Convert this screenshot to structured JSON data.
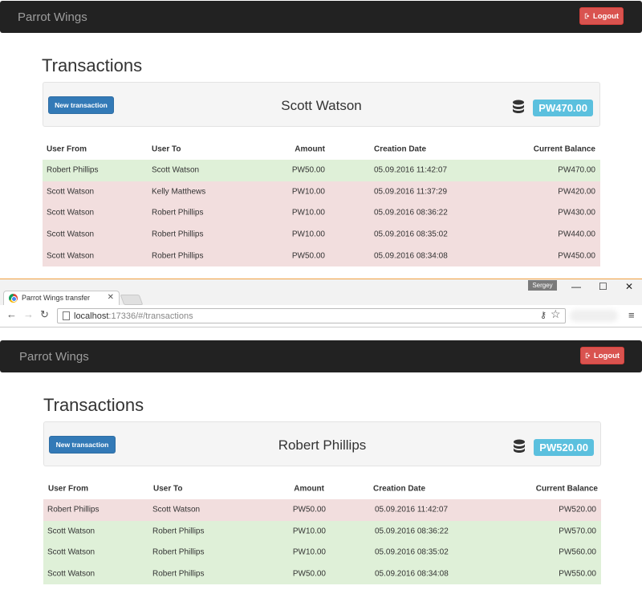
{
  "app": {
    "brand": "Parrot Wings",
    "logout_label": "Logout"
  },
  "table_headers": [
    "User From",
    "User To",
    "Amount",
    "Creation Date",
    "Current Balance"
  ],
  "top_view": {
    "title": "Transactions",
    "new_transaction_label": "New transaction",
    "user_name": "Scott Watson",
    "balance": "PW470.00",
    "rows": [
      {
        "status": "green",
        "from": "Robert Phillips",
        "to": "Scott Watson",
        "amount": "PW50.00",
        "date": "05.09.2016 11:42:07",
        "balance": "PW470.00"
      },
      {
        "status": "red",
        "from": "Scott Watson",
        "to": "Kelly Matthews",
        "amount": "PW10.00",
        "date": "05.09.2016 11:37:29",
        "balance": "PW420.00"
      },
      {
        "status": "red",
        "from": "Scott Watson",
        "to": "Robert Phillips",
        "amount": "PW10.00",
        "date": "05.09.2016 08:36:22",
        "balance": "PW430.00"
      },
      {
        "status": "red",
        "from": "Scott Watson",
        "to": "Robert Phillips",
        "amount": "PW10.00",
        "date": "05.09.2016 08:35:02",
        "balance": "PW440.00"
      },
      {
        "status": "red",
        "from": "Scott Watson",
        "to": "Robert Phillips",
        "amount": "PW50.00",
        "date": "05.09.2016 08:34:08",
        "balance": "PW450.00"
      }
    ]
  },
  "browser": {
    "tab_title": "Parrot Wings transfer",
    "profile": "Sergey",
    "url_host": "localhost",
    "url_path": ":17336/#/transactions"
  },
  "bottom_view": {
    "title": "Transactions",
    "new_transaction_label": "New transaction",
    "user_name": "Robert Phillips",
    "balance": "PW520.00",
    "rows": [
      {
        "status": "red",
        "from": "Robert Phillips",
        "to": "Scott Watson",
        "amount": "PW50.00",
        "date": "05.09.2016 11:42:07",
        "balance": "PW520.00"
      },
      {
        "status": "green",
        "from": "Scott Watson",
        "to": "Robert Phillips",
        "amount": "PW10.00",
        "date": "05.09.2016 08:36:22",
        "balance": "PW570.00"
      },
      {
        "status": "green",
        "from": "Scott Watson",
        "to": "Robert Phillips",
        "amount": "PW10.00",
        "date": "05.09.2016 08:35:02",
        "balance": "PW560.00"
      },
      {
        "status": "green",
        "from": "Scott Watson",
        "to": "Robert Phillips",
        "amount": "PW50.00",
        "date": "05.09.2016 08:34:08",
        "balance": "PW550.00"
      }
    ]
  },
  "colors": {
    "credit_row": "#dff0d8",
    "debit_row": "#f2dede",
    "navbar": "#222222",
    "primary": "#337ab7",
    "danger": "#d9534f",
    "info": "#5bc0de"
  }
}
